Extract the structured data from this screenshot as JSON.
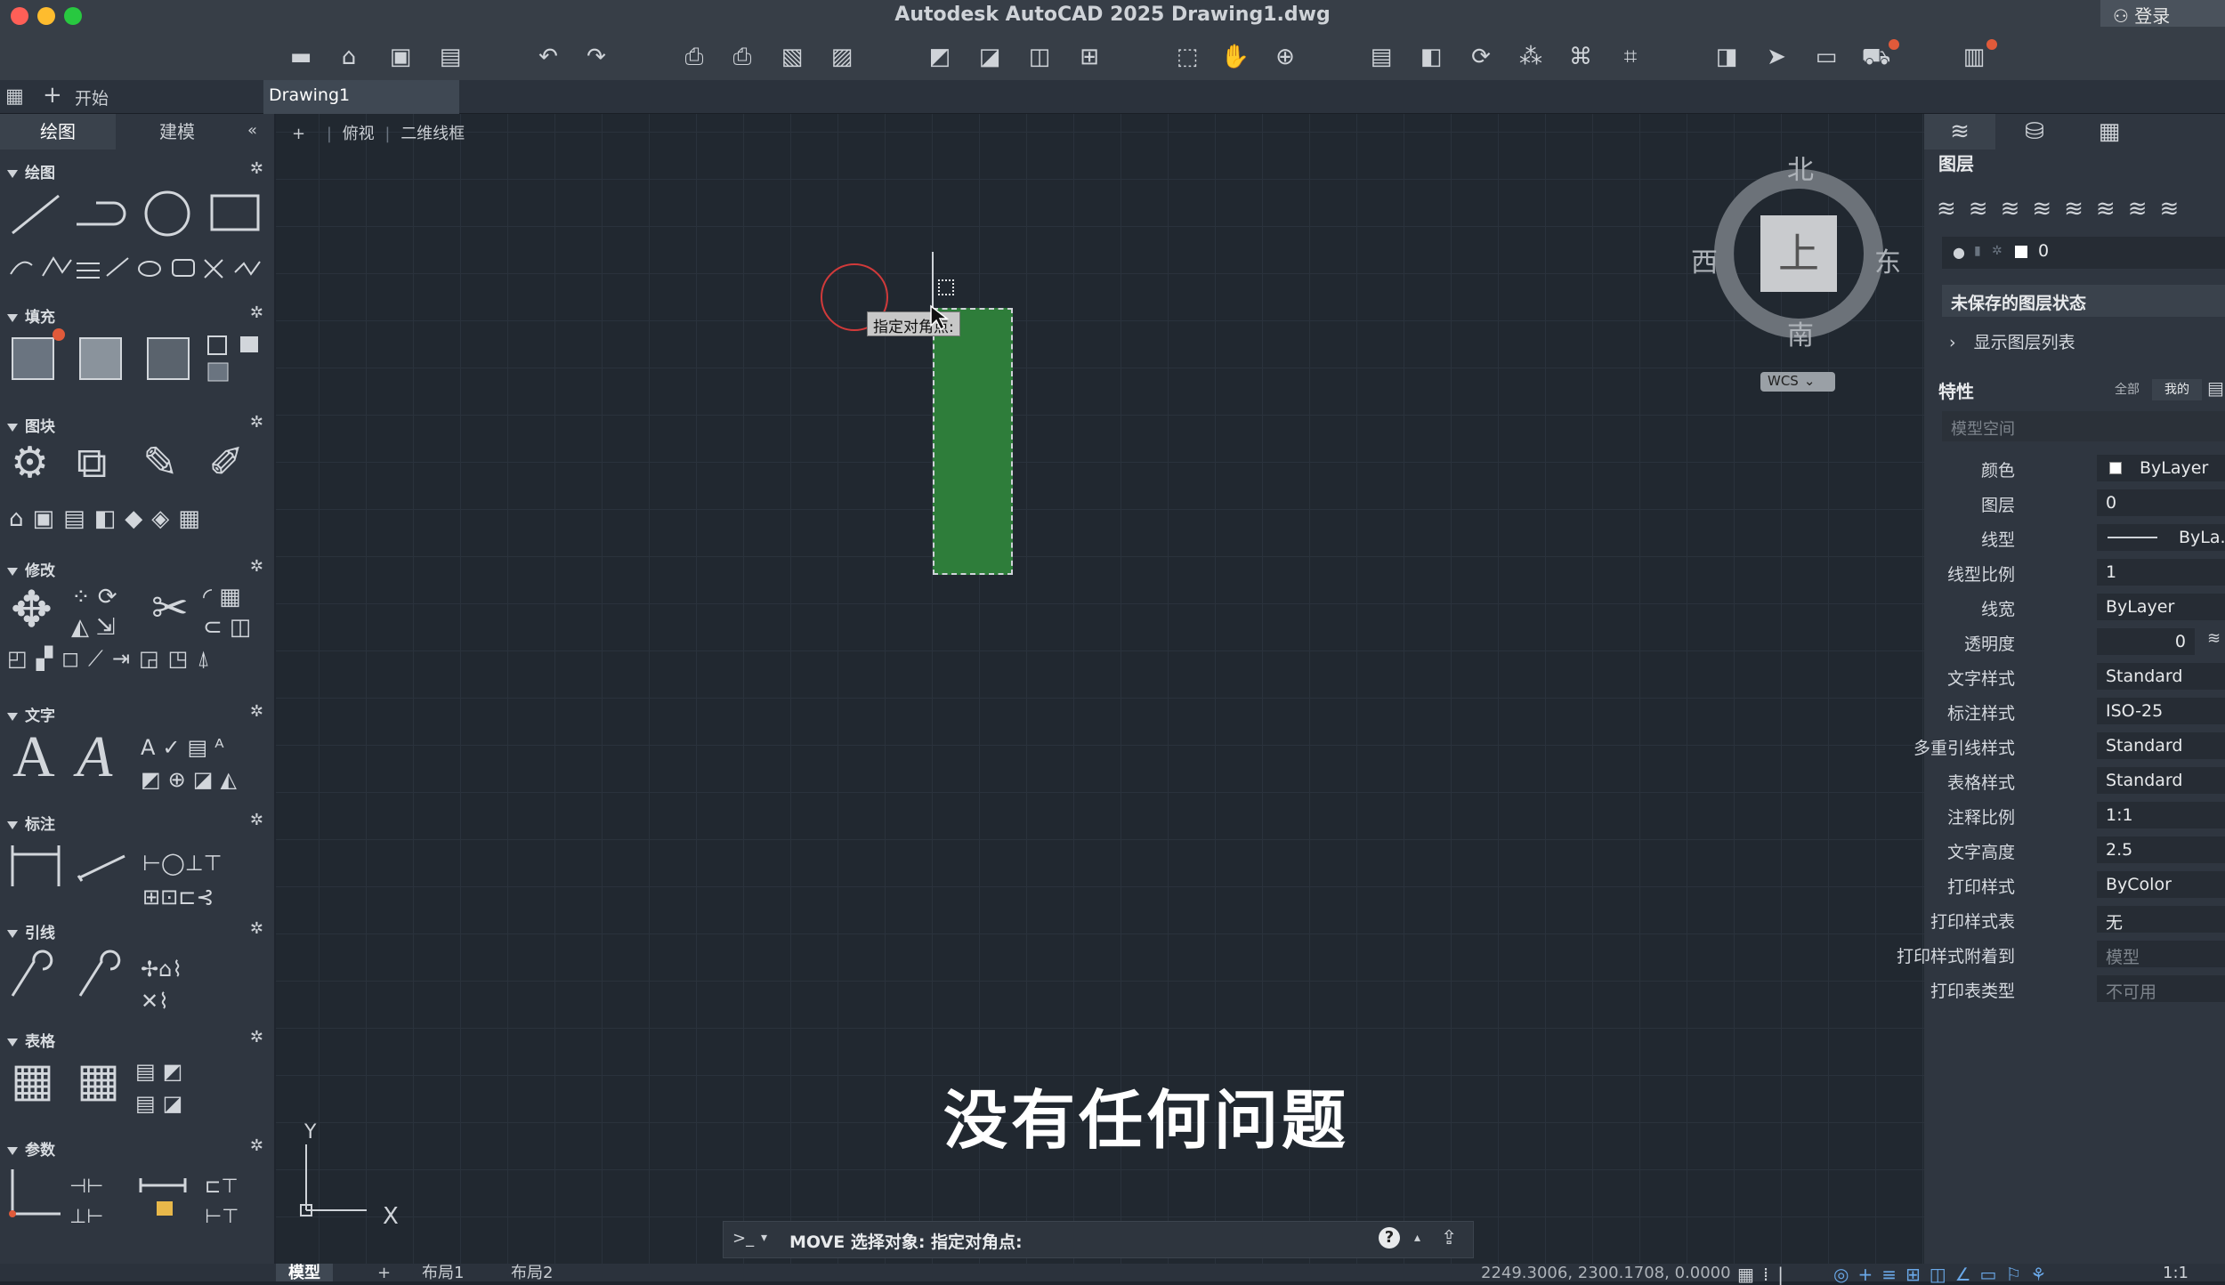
{
  "app_title": "Autodesk AutoCAD 2025    Drawing1.dwg",
  "login": {
    "icon": "user-icon",
    "label": "登录"
  },
  "tabs": {
    "start_label": "开始",
    "drawing_label": "Drawing1"
  },
  "left_panel": {
    "tabs": [
      "绘图",
      "建模"
    ],
    "sections": [
      "绘图",
      "填充",
      "图块",
      "修改",
      "文字",
      "标注",
      "引线",
      "表格",
      "参数"
    ]
  },
  "viewport_controls": {
    "plus": "+",
    "view": "俯视",
    "style": "二维线框"
  },
  "viewcube": {
    "north": "北",
    "south": "南",
    "east": "东",
    "west": "西",
    "face": "上",
    "wcs": "WCS"
  },
  "tooltip": "指定对角点:",
  "ucs": {
    "y": "Y",
    "x": "X"
  },
  "layers": {
    "title": "图层",
    "current_layer": "0",
    "state": "未保存的图层状态",
    "show_list": "显示图层列表"
  },
  "properties": {
    "title": "特性",
    "filter_all": "全部",
    "filter_mine": "我的",
    "space": "模型空间",
    "rows": [
      {
        "label": "颜色",
        "value": "ByLayer"
      },
      {
        "label": "图层",
        "value": "0"
      },
      {
        "label": "线型",
        "value": "ByLa.."
      },
      {
        "label": "线型比例",
        "value": "1"
      },
      {
        "label": "线宽",
        "value": "ByLayer"
      },
      {
        "label": "透明度",
        "value": "0"
      },
      {
        "label": "文字样式",
        "value": "Standard"
      },
      {
        "label": "标注样式",
        "value": "ISO-25"
      },
      {
        "label": "多重引线样式",
        "value": "Standard"
      },
      {
        "label": "表格样式",
        "value": "Standard"
      },
      {
        "label": "注释比例",
        "value": "1:1"
      },
      {
        "label": "文字高度",
        "value": "2.5"
      },
      {
        "label": "打印样式",
        "value": "ByColor"
      },
      {
        "label": "打印样式表",
        "value": "无"
      },
      {
        "label": "打印样式附着到",
        "value": "模型"
      },
      {
        "label": "打印表类型",
        "value": "不可用"
      }
    ]
  },
  "command_line": {
    "prompt": ">_",
    "text": "MOVE 选择对象: 指定对角点:"
  },
  "status_bar": {
    "tabs": [
      "模型",
      "+",
      "布局1",
      "布局2"
    ],
    "coords": "2249.3006, 2300.1708, 0.0000",
    "scale": "1:1"
  },
  "subtitle": "没有任何问题",
  "colors": {
    "selection_fill": "#2e7d3a",
    "accent_red": "#e05a3a",
    "pickbox": "#d13a3a"
  }
}
